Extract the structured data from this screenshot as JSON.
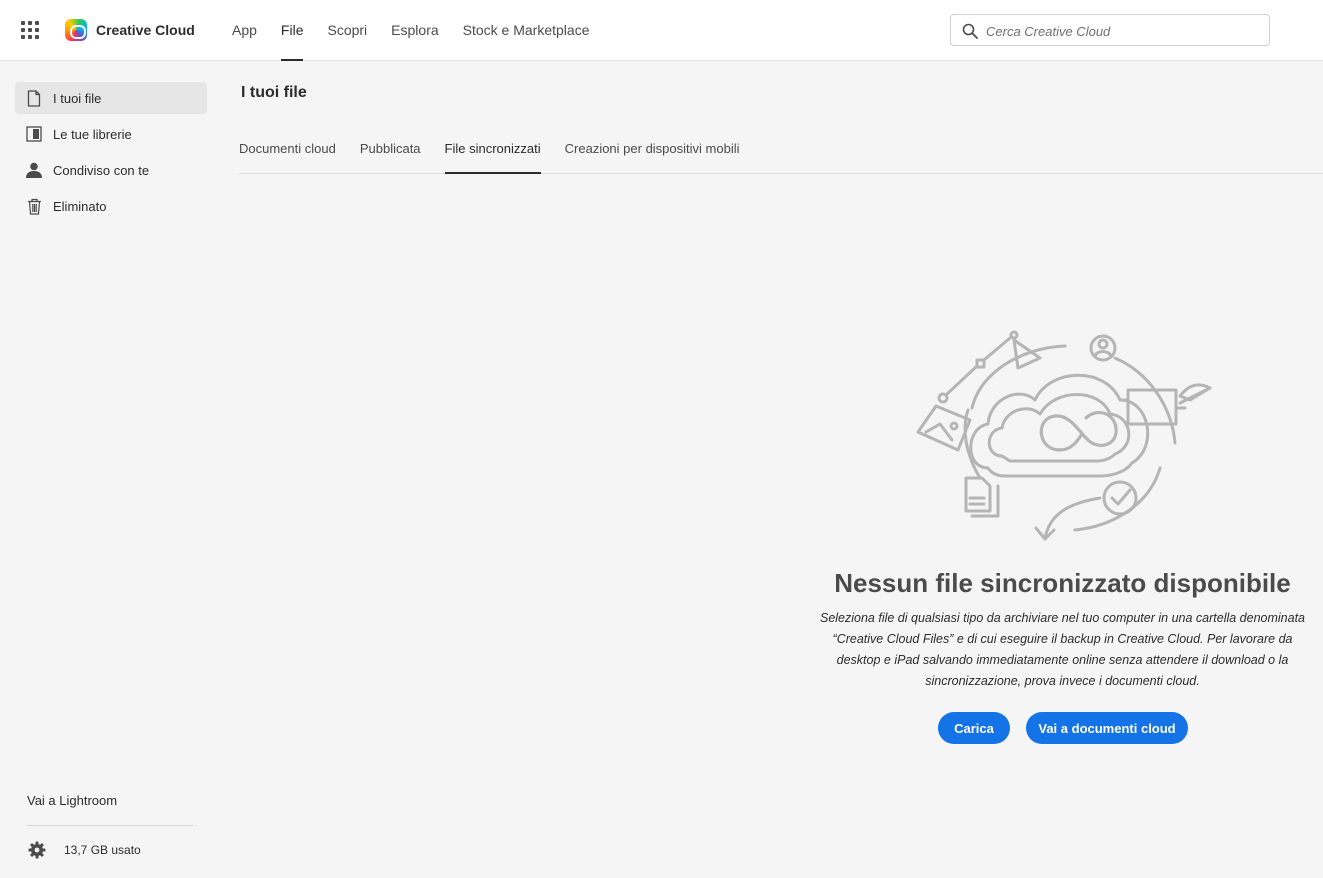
{
  "app": {
    "name": "Creative Cloud"
  },
  "nav": {
    "items": [
      {
        "label": "App",
        "active": false
      },
      {
        "label": "File",
        "active": true
      },
      {
        "label": "Scopri",
        "active": false
      },
      {
        "label": "Esplora",
        "active": false
      },
      {
        "label": "Stock e Marketplace",
        "active": false
      }
    ]
  },
  "search": {
    "placeholder": "Cerca Creative Cloud",
    "value": ""
  },
  "sidebar": {
    "items": [
      {
        "label": "I tuoi file",
        "icon": "file-icon",
        "active": true
      },
      {
        "label": "Le tue librerie",
        "icon": "library-icon",
        "active": false
      },
      {
        "label": "Condiviso con te",
        "icon": "person-icon",
        "active": false
      },
      {
        "label": "Eliminato",
        "icon": "trash-icon",
        "active": false
      }
    ],
    "lightroom_link": "Vai a Lightroom",
    "storage": "13,7 GB usato"
  },
  "main": {
    "title": "I tuoi file",
    "tabs": [
      {
        "label": "Documenti cloud",
        "active": false
      },
      {
        "label": "Pubblicata",
        "active": false
      },
      {
        "label": "File sincronizzati",
        "active": true
      },
      {
        "label": "Creazioni per dispositivi mobili",
        "active": false
      }
    ],
    "empty_state": {
      "illustration": "creative-cloud-sync-illustration",
      "title": "Nessun file sincronizzato disponibile",
      "description": "Seleziona file di qualsiasi tipo da archiviare nel tuo computer in una cartella denominata “Creative Cloud Files” e di cui eseguire il backup in Creative Cloud. Per lavorare da desktop e iPad salvando immediatamente online senza attendere il download o la sincronizzazione, prova invece i documenti cloud.",
      "upload_button": "Carica",
      "cloud_docs_button": "Vai a documenti cloud"
    }
  },
  "colors": {
    "accent": "#1473e6",
    "background": "#f5f5f5",
    "topbar": "#ffffff"
  }
}
